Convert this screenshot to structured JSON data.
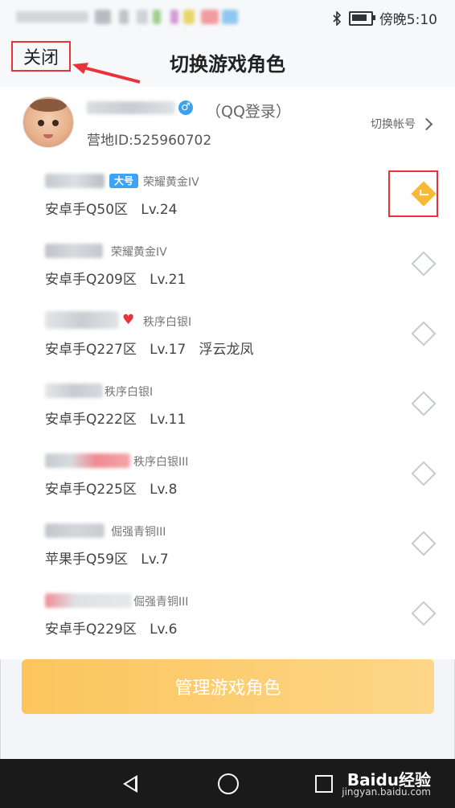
{
  "status_bar": {
    "time": "傍晚5:10"
  },
  "header": {
    "close_label": "关闭",
    "title": "切换游戏角色"
  },
  "account": {
    "login_type": "（QQ登录）",
    "camp_id": "营地ID:525960702",
    "switch_label": "切换帐号"
  },
  "roles": [
    {
      "rank": "荣耀黄金IV",
      "server": "安卓手Q50区",
      "level": "Lv.24",
      "extra": "",
      "big_tag": "大号",
      "selected": true
    },
    {
      "rank": "荣耀黄金IV",
      "server": "安卓手Q209区",
      "level": "Lv.21",
      "extra": "",
      "selected": false
    },
    {
      "rank": "秩序白银I",
      "server": "安卓手Q227区",
      "level": "Lv.17",
      "extra": "浮云龙凤",
      "selected": false
    },
    {
      "rank": "秩序白银I",
      "server": "安卓手Q222区",
      "level": "Lv.11",
      "extra": "",
      "selected": false
    },
    {
      "rank": "秩序白银III",
      "server": "安卓手Q225区",
      "level": "Lv.8",
      "extra": "",
      "selected": false
    },
    {
      "rank": "倔强青铜III",
      "server": "苹果手Q59区",
      "level": "Lv.7",
      "extra": "",
      "selected": false
    },
    {
      "rank": "倔强青铜III",
      "server": "安卓手Q229区",
      "level": "Lv.6",
      "extra": "",
      "selected": false
    }
  ],
  "manage_button": "管理游戏角色",
  "watermark": {
    "brand": "Baidu经验",
    "url": "jingyan.baidu.com"
  },
  "colors": {
    "accent": "#f8b935",
    "annotation_red": "#e8333a",
    "tag_blue": "#3ea3f2"
  }
}
